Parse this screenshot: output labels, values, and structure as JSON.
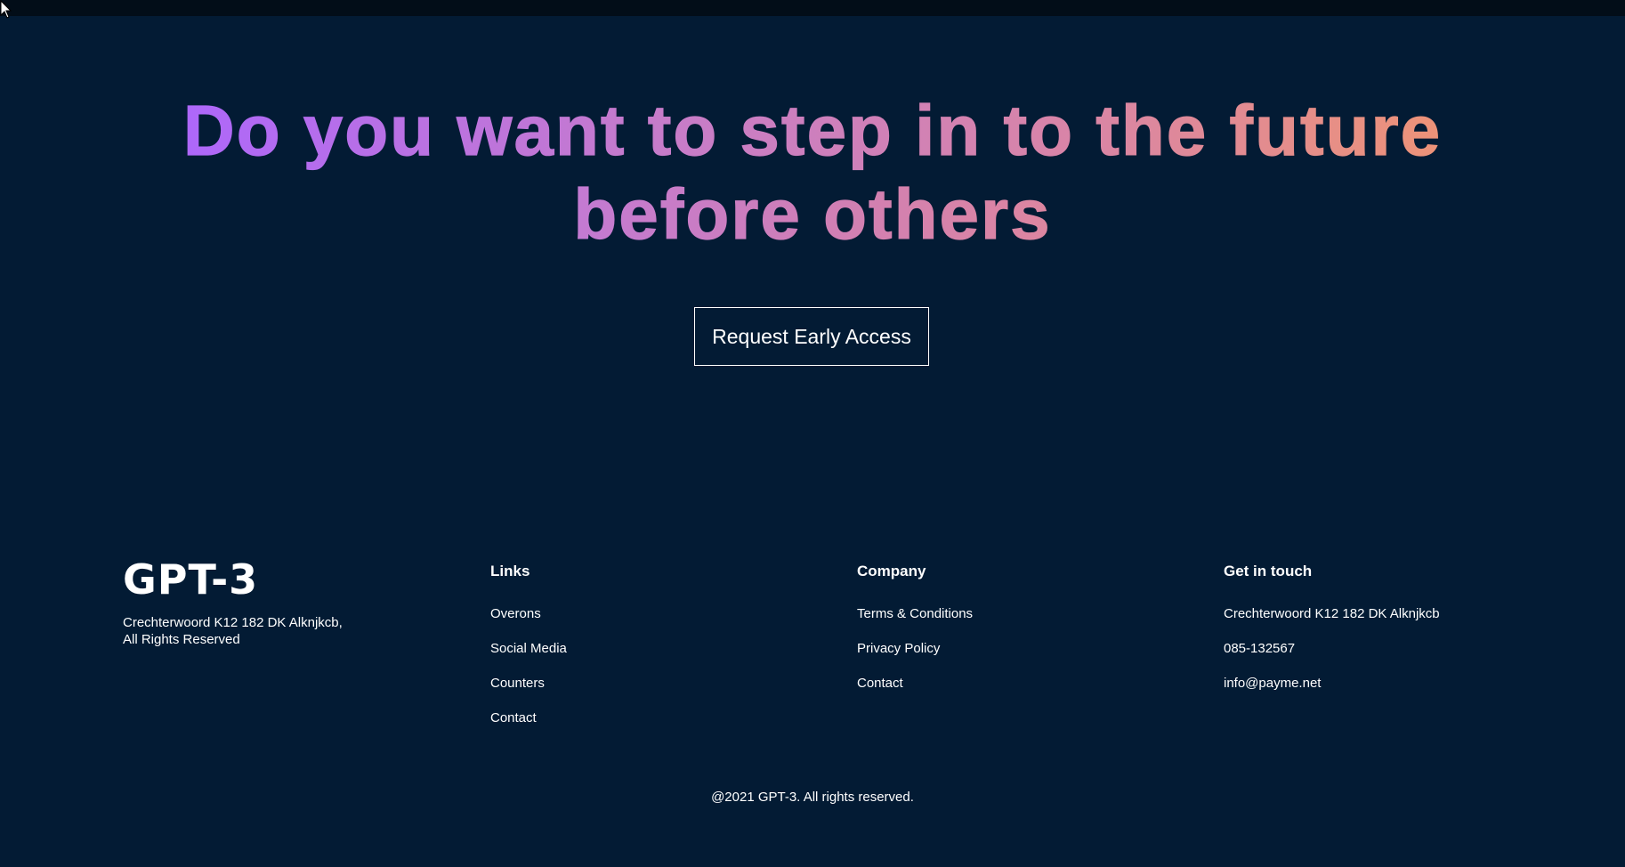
{
  "hero": {
    "headline_line1": "Do you want to step in to the future",
    "headline_line2": "before others",
    "cta_label": "Request Early Access"
  },
  "footer": {
    "logo": "GPT-3",
    "address_line1": "Crechterwoord K12 182 DK Alknjkcb,",
    "address_line2": "All Rights Reserved",
    "links": {
      "title": "Links",
      "items": [
        "Overons",
        "Social Media",
        "Counters",
        "Contact"
      ]
    },
    "company": {
      "title": "Company",
      "items": [
        "Terms & Conditions",
        "Privacy Policy",
        "Contact"
      ]
    },
    "contact": {
      "title": "Get in touch",
      "items": [
        "Crechterwoord K12 182 DK Alknjkcb",
        "085-132567",
        "info@payme.net"
      ]
    },
    "copyright": "@2021 GPT-3. All rights reserved."
  },
  "colors": {
    "background": "#031b34",
    "gradient_start": "#ae67fa",
    "gradient_end": "#f49867"
  },
  "icons": {
    "cursor": "mouse-pointer-icon"
  }
}
